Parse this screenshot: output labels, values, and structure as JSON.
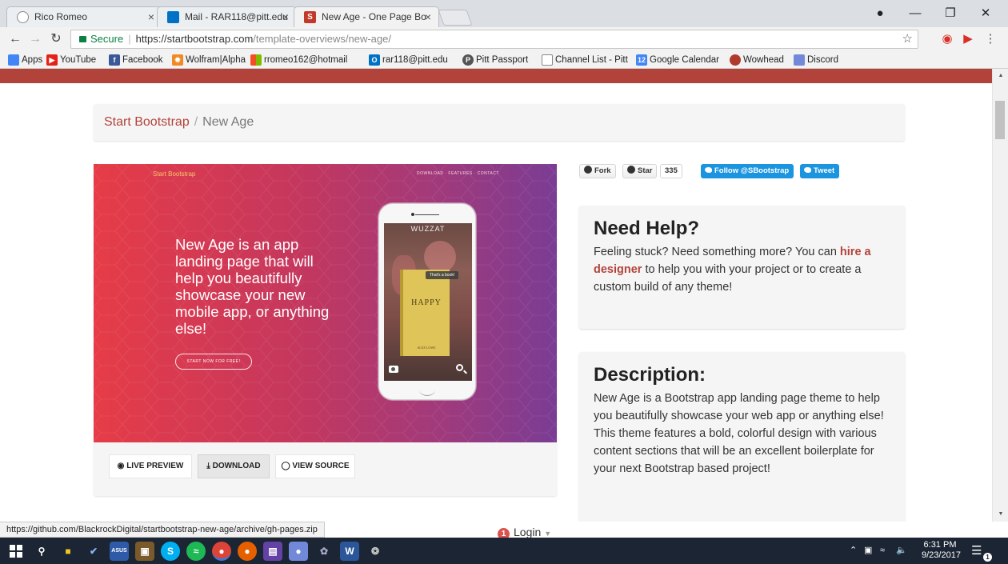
{
  "browser": {
    "tabs": [
      {
        "title": "Rico Romeo",
        "icon": "profile-icon"
      },
      {
        "title": "Mail - RAR118@pitt.edu",
        "icon": "outlook-icon"
      },
      {
        "title": "New Age - One Page Bo",
        "icon": "startbootstrap-icon"
      }
    ],
    "close_glyph": "×",
    "secure_label": "Secure",
    "url_base": "https://startbootstrap.com",
    "url_path": "/template-overviews/new-age/",
    "bookmarks": [
      {
        "label": "Apps",
        "icon": "apps-grid-icon",
        "color": "#4285f4"
      },
      {
        "label": "YouTube",
        "icon": "youtube-icon",
        "color": "#e62117"
      },
      {
        "label": "Facebook",
        "icon": "facebook-icon",
        "color": "#3b5998"
      },
      {
        "label": "Wolfram|Alpha",
        "icon": "wolfram-icon",
        "color": "#f08a24"
      },
      {
        "label": "rromeo162@hotmail",
        "icon": "microsoft-icon",
        "color": "#7fba00"
      },
      {
        "label": "rar118@pitt.edu",
        "icon": "outlook-icon",
        "color": "#0072c6"
      },
      {
        "label": "Pitt Passport",
        "icon": "pitt-icon",
        "color": "#555555"
      },
      {
        "label": "Channel List - Pitt",
        "icon": "page-icon",
        "color": "#888888"
      },
      {
        "label": "Google Calendar",
        "icon": "calendar-icon",
        "color": "#4285f4"
      },
      {
        "label": "Wowhead",
        "icon": "wowhead-icon",
        "color": "#b03a2e"
      },
      {
        "label": "Discord",
        "icon": "discord-icon",
        "color": "#7289da"
      }
    ],
    "status_url": "https://github.com/BlackrockDigital/startbootstrap-new-age/archive/gh-pages.zip"
  },
  "page": {
    "breadcrumb_root": "Start Bootstrap",
    "breadcrumb_sep": "/",
    "breadcrumb_current": "New Age",
    "preview": {
      "brand": "Start Bootstrap",
      "nav": "DOWNLOAD · FEATURES · CONTACT",
      "headline": "New Age is an app landing page that will help you beautifully showcase your new mobile app, or anything else!",
      "cta": "START NOW FOR FREE!",
      "phone_app": "WUZZAT",
      "bubble": "That's a book!",
      "book_title": "HAPPY",
      "book_author": "ALEX LOWE"
    },
    "buttons": {
      "live_preview": "LIVE PREVIEW",
      "download": "DOWNLOAD",
      "view_source": "VIEW SOURCE"
    },
    "social": {
      "fork": "Fork",
      "star": "Star",
      "star_count": "335",
      "follow": "Follow @SBootstrap",
      "tweet": "Tweet"
    },
    "help": {
      "title": "Need Help?",
      "text_before": "Feeling stuck? Need something more? You can ",
      "link": "hire a designer",
      "text_after": " to help you with your project or to create a custom build of any theme!"
    },
    "description": {
      "title": "Description:",
      "text": "New Age is a Bootstrap app landing page theme to help you beautifully showcase your web app or anything else! This theme features a bold, colorful design with various content sections that will be an excellent boilerplate for your next Bootstrap based project!"
    },
    "login": {
      "badge": "1",
      "label": "Login"
    },
    "accent_color": "#b2433a"
  },
  "taskbar": {
    "time": "6:31 PM",
    "date": "9/23/2017",
    "notification_count": "1"
  }
}
